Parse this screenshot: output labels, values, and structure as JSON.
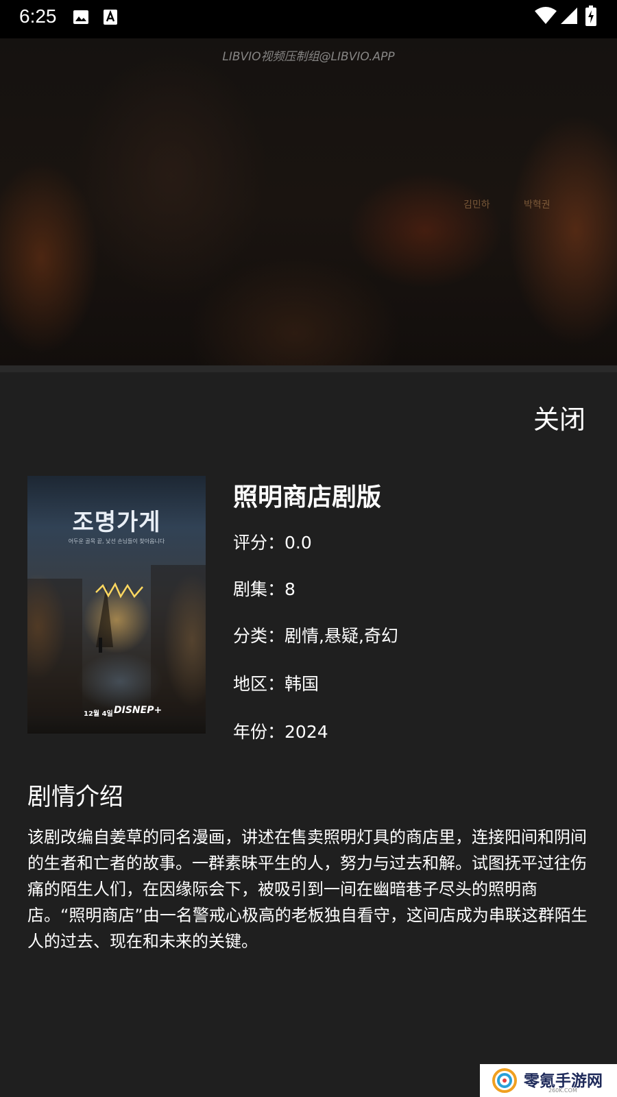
{
  "status_bar": {
    "time": "6:25",
    "left_icons": [
      "image-icon",
      "font-download-icon"
    ],
    "right_icons": [
      "wifi-icon",
      "signal-icon",
      "battery-charging-icon"
    ]
  },
  "video": {
    "watermark": "LIBVIO视频压制组@LIBVIO.APP",
    "credits": [
      "김민하",
      "박혁권"
    ]
  },
  "close_label": "关闭",
  "poster": {
    "title_text": "조명가게",
    "subtitle_text": "어두운 골목 끝, 낯선 손님들이 찾아옵니다",
    "date_text": "12월 4일",
    "brand_text": "DISNEP+"
  },
  "details": {
    "title": "照明商店剧版",
    "rating_label": "评分：",
    "rating_value": "0.0",
    "episodes_label": "剧集：",
    "episodes_value": "8",
    "genre_label": "分类：",
    "genre_value": "剧情,悬疑,奇幻",
    "region_label": "地区：",
    "region_value": "韩国",
    "year_label": "年份：",
    "year_value": "2024"
  },
  "synopsis": {
    "heading": "剧情介绍",
    "text": "该剧改编自姜草的同名漫画，讲述在售卖照明灯具的商店里，连接阳间和阴间的生者和亡者的故事。一群素昧平生的人，努力与过去和解。试图抚平过往伤痛的陌生人们，在因缘际会下，被吸引到一间在幽暗巷子尽头的照明商店。“照明商店”由一名警戒心极高的老板独自看守，这间店成为串联这群陌生人的过去、现在和未来的关键。"
  },
  "corner_logo": {
    "text": "零氪手游网",
    "sub": "260K.COM"
  }
}
